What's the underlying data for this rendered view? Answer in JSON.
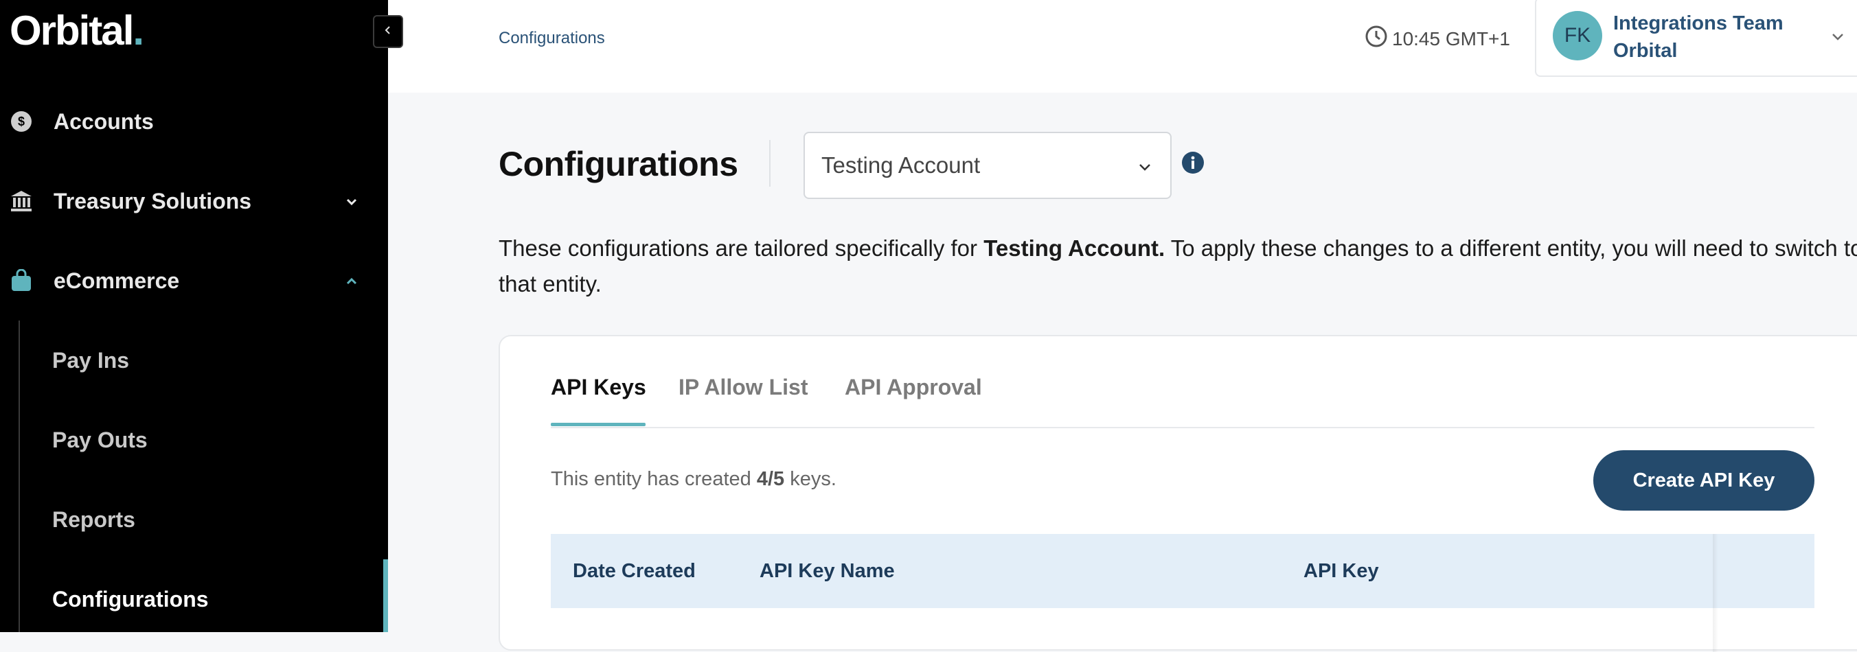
{
  "sidebar": {
    "logo_text": "Orbital",
    "logo_dot": ".",
    "items": [
      {
        "label": "Accounts",
        "icon": "dollar-coin-icon"
      },
      {
        "label": "Treasury Solutions",
        "icon": "bank-icon"
      },
      {
        "label": "eCommerce",
        "icon": "shopping-bag-icon"
      }
    ],
    "sub_items": [
      {
        "label": "Pay Ins"
      },
      {
        "label": "Pay Outs"
      },
      {
        "label": "Reports"
      },
      {
        "label": "Configurations"
      }
    ],
    "accent_color": "#5fb4bd"
  },
  "header": {
    "breadcrumb": "Configurations",
    "time": "10:45 GMT+1",
    "user": {
      "initials": "FK",
      "name": "Integrations Team Orbital"
    }
  },
  "main": {
    "title": "Configurations",
    "account_select": {
      "value": "Testing Account"
    },
    "description": {
      "before": "These configurations are tailored specifically for ",
      "bold": "Testing Account.",
      "after": " To apply these changes to a different entity, you will need to switch to that entity."
    },
    "tabs": [
      {
        "label": "API Keys",
        "active": true
      },
      {
        "label": "IP Allow List",
        "active": false
      },
      {
        "label": "API Approval",
        "active": false
      }
    ],
    "key_count": {
      "before": "This entity has created ",
      "count": "4/5",
      "after": " keys."
    },
    "create_button": "Create API Key",
    "table": {
      "columns": [
        "Date Created",
        "API Key Name",
        "API Key"
      ]
    },
    "brand_color": "#244a6c"
  }
}
